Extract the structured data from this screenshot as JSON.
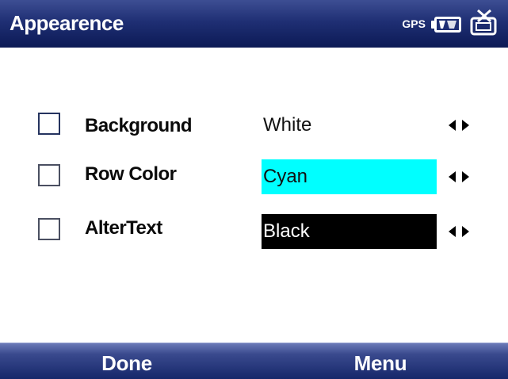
{
  "titlebar": {
    "title": "Appearence",
    "status": {
      "gps_label": "GPS",
      "icons": [
        "battery-icon",
        "connectivity-off-icon"
      ]
    }
  },
  "settings": {
    "rows": [
      {
        "label": "Background",
        "checked": false,
        "value": "White",
        "value_bg": "#ffffff",
        "value_fg": "#111111"
      },
      {
        "label": "Row Color",
        "checked": false,
        "value": "Cyan",
        "value_bg": "#00ffff",
        "value_fg": "#111111"
      },
      {
        "label": "AlterText",
        "checked": false,
        "value": "Black",
        "value_bg": "#000000",
        "value_fg": "#ffffff"
      }
    ]
  },
  "softkeys": {
    "left": "Done",
    "right": "Menu"
  },
  "colors": {
    "titlebar": "#1f2f74",
    "softbar": "#16276a",
    "text_light": "#ffffff"
  }
}
